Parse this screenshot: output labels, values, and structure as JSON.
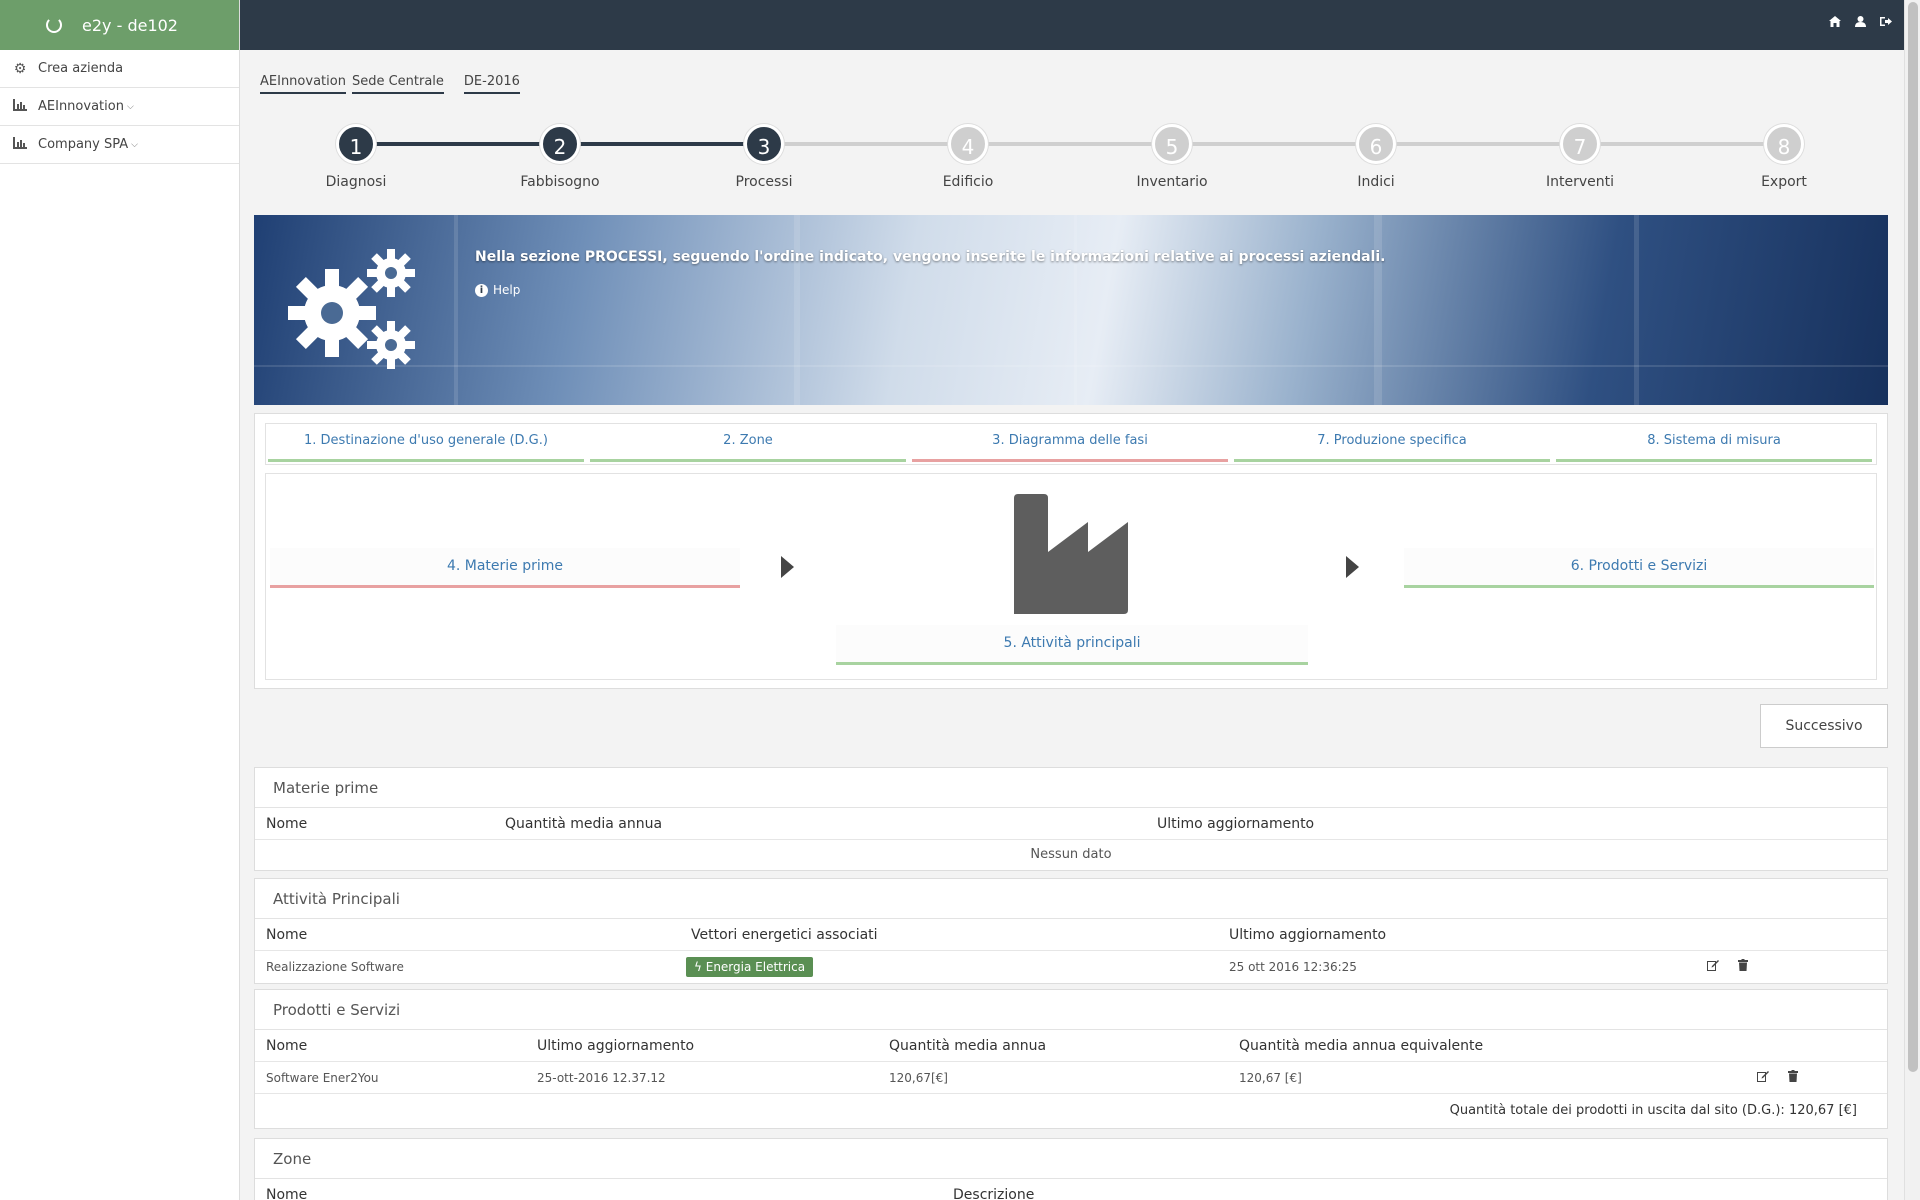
{
  "app": {
    "title": "e2y - de102"
  },
  "sidebar": {
    "items": [
      {
        "label": "Crea azienda",
        "icon": "gear-icon"
      },
      {
        "label": "AEInnovation",
        "icon": "bar-chart-icon",
        "chevron": "⌵"
      },
      {
        "label": "Company SPA",
        "icon": "bar-chart-icon",
        "chevron": "⌵"
      }
    ]
  },
  "topbar": {
    "icons": [
      "home-icon",
      "user-icon",
      "logout-icon"
    ]
  },
  "breadcrumb": [
    "AEInnovation",
    "Sede Centrale",
    "DE-2016"
  ],
  "stepper": {
    "current": 3,
    "steps": [
      {
        "num": "1",
        "label": "Diagnosi"
      },
      {
        "num": "2",
        "label": "Fabbisogno"
      },
      {
        "num": "3",
        "label": "Processi"
      },
      {
        "num": "4",
        "label": "Edificio"
      },
      {
        "num": "5",
        "label": "Inventario"
      },
      {
        "num": "6",
        "label": "Indici"
      },
      {
        "num": "7",
        "label": "Interventi"
      },
      {
        "num": "8",
        "label": "Export"
      }
    ]
  },
  "banner": {
    "text": "Nella sezione PROCESSI, seguendo l'ordine indicato, vengono inserite le informazioni relative ai processi aziendali.",
    "help": "Help"
  },
  "process_tabs": [
    {
      "label": "1. Destinazione d'uso generale (D.G.)",
      "status": "complete"
    },
    {
      "label": "2. Zone",
      "status": "complete"
    },
    {
      "label": "3. Diagramma delle fasi",
      "status": "incomplete"
    },
    {
      "label": "7. Produzione specifica",
      "status": "complete"
    },
    {
      "label": "8. Sistema di misura",
      "status": "complete"
    }
  ],
  "flow": {
    "input": {
      "label": "4. Materie prime",
      "status": "incomplete"
    },
    "main": {
      "label": "5. Attività principali",
      "status": "complete"
    },
    "output": {
      "label": "6. Prodotti e Servizi",
      "status": "complete"
    }
  },
  "next_button": "Successivo",
  "materie_prime": {
    "title": "Materie prime",
    "columns": [
      "Nome",
      "Quantità media annua",
      "Ultimo aggiornamento"
    ],
    "empty": "Nessun dato"
  },
  "attivita": {
    "title": "Attività Principali",
    "columns": [
      "Nome",
      "Vettori energetici associati",
      "Ultimo aggiornamento"
    ],
    "rows": [
      {
        "nome": "Realizzazione Software",
        "vettore": "Energia Elettrica",
        "aggiornamento": "25 ott 2016 12:36:25"
      }
    ]
  },
  "prodotti": {
    "title": "Prodotti e Servizi",
    "columns": [
      "Nome",
      "Ultimo aggiornamento",
      "Quantità media annua",
      "Quantità media annua equivalente"
    ],
    "rows": [
      {
        "nome": "Software Ener2You",
        "aggiornamento": "25-ott-2016 12.37.12",
        "quantita": "120,67[€]",
        "equivalente": "120,67 [€]"
      }
    ],
    "total_label": "Quantità totale dei prodotti in uscita dal sito (D.G.):",
    "total_value": "120,67 [€]"
  },
  "zone": {
    "title": "Zone",
    "columns": [
      "Nome",
      "Descrizione"
    ]
  },
  "colors": {
    "brand": "#6d9e6a",
    "topbar": "#2d3a48",
    "step_done": "#2d3a48",
    "step_todo": "#cfcfcf",
    "tab_complete": "#a8d3a0",
    "tab_incomplete": "#e8a1a1",
    "link": "#3d7ab0",
    "badge": "#5a8f53"
  }
}
